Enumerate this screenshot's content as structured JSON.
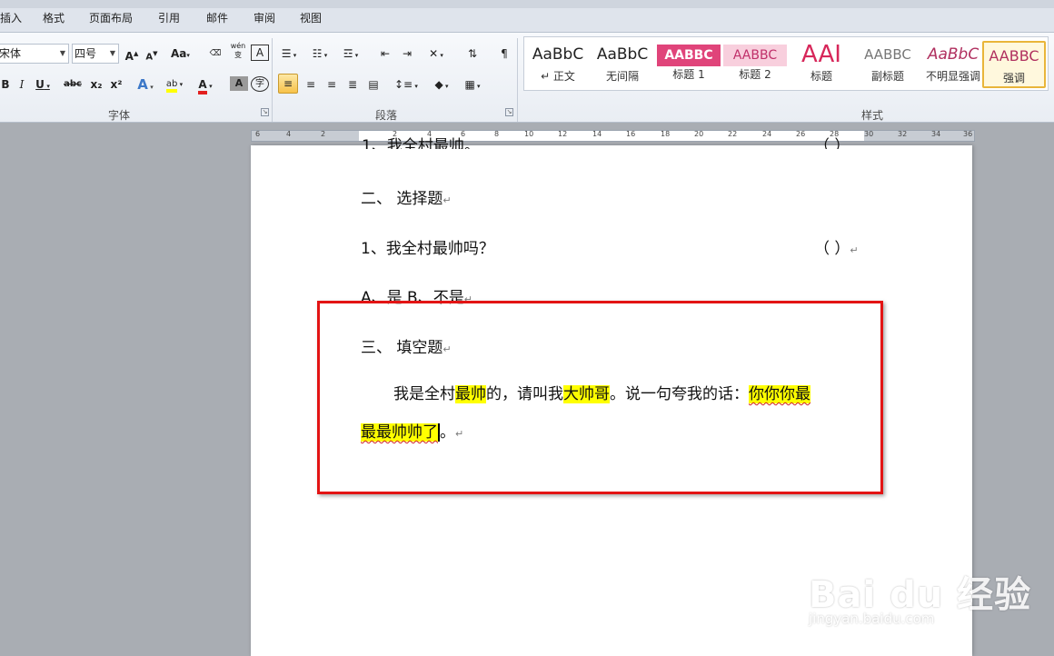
{
  "tabs": [
    "插入",
    "格式",
    "页面布局",
    "引用",
    "邮件",
    "审阅",
    "视图"
  ],
  "font": {
    "name": "宋体",
    "size": "四号",
    "group_label": "字体",
    "grow_label": "A",
    "shrink_label": "A",
    "case_label": "Aa",
    "pinyin_label": "wén",
    "char_border_label": "A",
    "bold_label": "B",
    "italic_label": "I",
    "underline_label": "U",
    "strike_label": "abc",
    "sub_label": "x₂",
    "sup_label": "x²",
    "highlight_label": "ab",
    "color_label": "A",
    "shade_label": "A",
    "enclose_label": "字"
  },
  "paragraph": {
    "group_label": "段落"
  },
  "styles": {
    "group_label": "样式",
    "items": [
      {
        "sample": "AaBbC",
        "name": "↵ 正文",
        "color": "#222222"
      },
      {
        "sample": "AaBbC",
        "name": "无间隔",
        "color": "#222222"
      },
      {
        "sample": "AABBC",
        "name": "标题 1",
        "color": "#ffffff"
      },
      {
        "sample": "AABBC",
        "name": "标题 2",
        "color": "#c0306a"
      },
      {
        "sample": "AAI",
        "name": "标题",
        "color": "#d7275a"
      },
      {
        "sample": "AABBC",
        "name": "副标题",
        "color": "#777777"
      },
      {
        "sample": "AaBbC",
        "name": "不明显强调",
        "color": "#b0305f"
      },
      {
        "sample": "AABBC",
        "name": "强调",
        "color": "#b0305f"
      }
    ]
  },
  "ruler": {
    "labels": [
      "6",
      "4",
      "2",
      "2",
      "4",
      "6",
      "8",
      "10",
      "12",
      "14",
      "16",
      "18",
      "20",
      "22",
      "24",
      "26",
      "28",
      "30",
      "32",
      "34",
      "36"
    ]
  },
  "document": {
    "partial_line": "1、我全村最帅。",
    "partial_paren": "（ ）",
    "section2": "二、  选择题",
    "q1": "1、我全村最帅吗？",
    "q1_paren": "（   ）",
    "options": "A、是        B、不是",
    "section3": "三、  填空题",
    "fill_a": "我是全村",
    "fill_b": "最帅",
    "fill_c": "的，请叫我",
    "fill_d": "大帅哥",
    "fill_e": "。说一句夸我的话：",
    "fill_f": "你你你最",
    "fill_g": "最最帅帅了",
    "fill_h": "。",
    "para_mark": "↵"
  },
  "watermark": {
    "brand": "Bai du 经验",
    "url": "jingyan.baidu.com"
  },
  "colors": {
    "highlight": "#ffff00",
    "annotation_box": "#e31414",
    "accent": "#f7c24a"
  }
}
